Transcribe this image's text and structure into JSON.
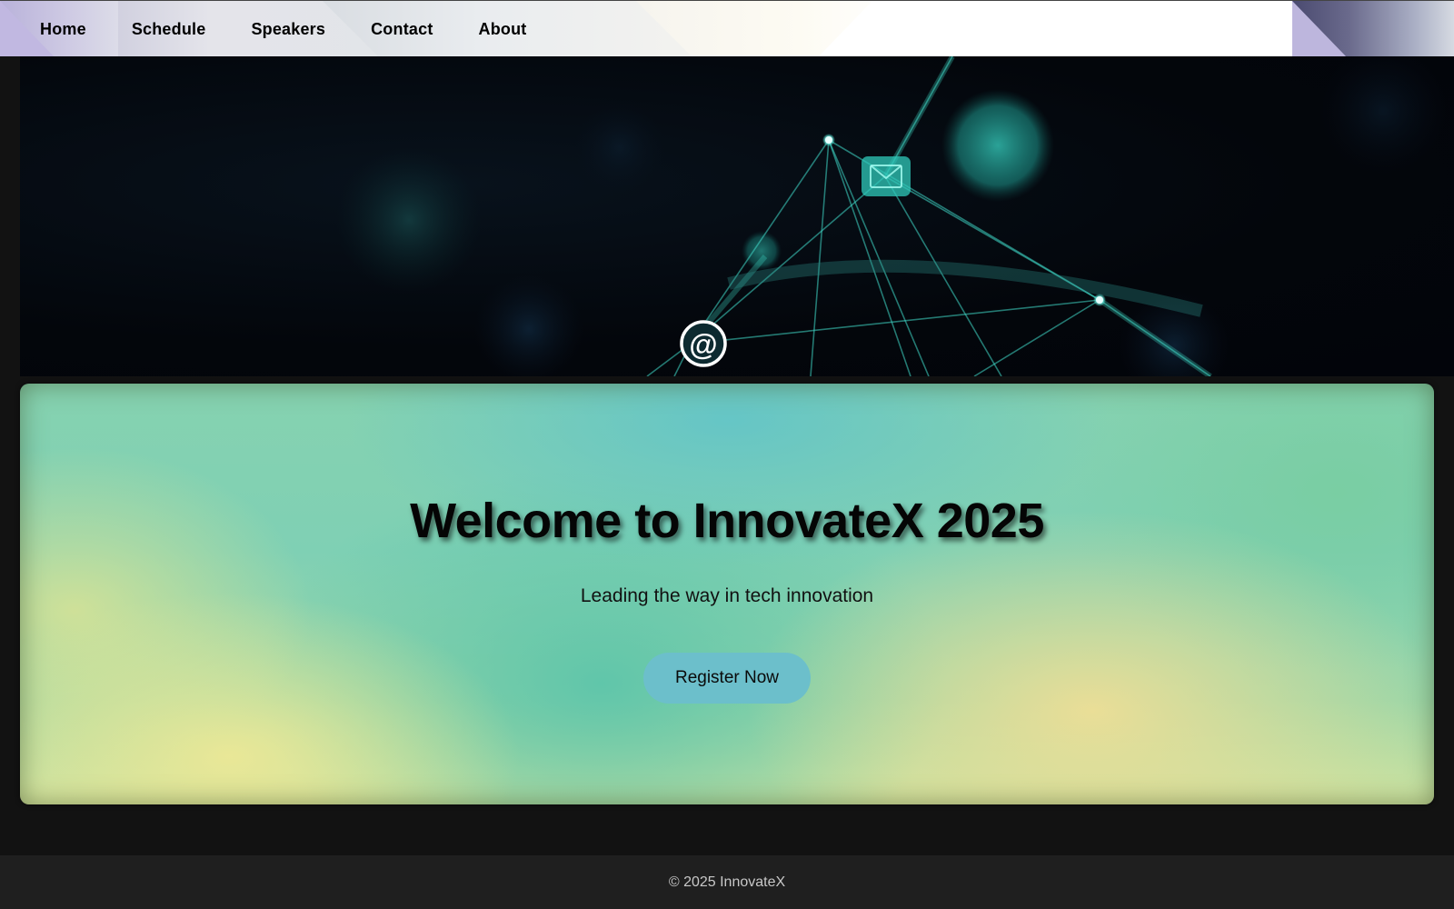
{
  "nav": {
    "items": [
      {
        "label": "Home"
      },
      {
        "label": "Schedule"
      },
      {
        "label": "Speakers"
      },
      {
        "label": "Contact"
      },
      {
        "label": "About"
      }
    ]
  },
  "banner": {
    "at_glyph": "@",
    "accent_color": "#3fd9c8"
  },
  "hero": {
    "title": "Welcome to InnovateX 2025",
    "subtitle": "Leading the way in tech innovation",
    "cta_label": "Register Now",
    "cta_color": "#6cbfcb"
  },
  "footer": {
    "text": "© 2025 InnovateX"
  }
}
